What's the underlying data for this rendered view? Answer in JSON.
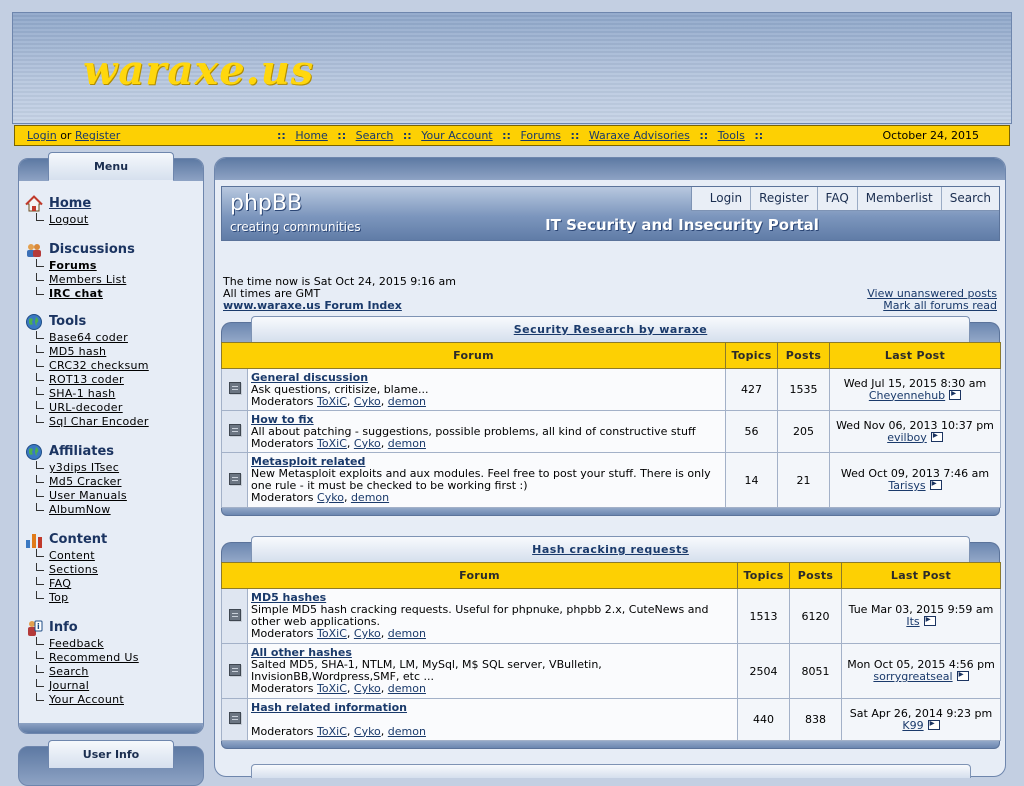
{
  "site": {
    "logo": "waraxe.us"
  },
  "navbar": {
    "login": "Login",
    "or": "or",
    "register": "Register",
    "links": [
      "Home",
      "Search",
      "Your Account",
      "Forums",
      "Waraxe Advisories",
      "Tools"
    ],
    "sep": "::",
    "date": "October 24, 2015"
  },
  "sidebar": {
    "menu_title": "Menu",
    "sections": [
      {
        "title": "Home",
        "icon": "home-icon",
        "items": [
          "Logout"
        ]
      },
      {
        "title": "Discussions",
        "icon": "users-icon",
        "items": [
          "Forums",
          "Members List",
          "IRC chat"
        ]
      },
      {
        "title": "Tools",
        "icon": "globe-icon",
        "items": [
          "Base64 coder",
          "MD5 hash",
          "CRC32 checksum",
          "ROT13 coder",
          "SHA-1 hash",
          "URL-decoder",
          "Sql Char Encoder"
        ]
      },
      {
        "title": "Affiliates",
        "icon": "globe-icon",
        "items": [
          "y3dips ITsec",
          "Md5 Cracker",
          "User Manuals",
          "AlbumNow"
        ]
      },
      {
        "title": "Content",
        "icon": "chart-icon",
        "items": [
          "Content",
          "Sections",
          "FAQ",
          "Top"
        ]
      },
      {
        "title": "Info",
        "icon": "info-icon",
        "items": [
          "Feedback",
          "Recommend Us",
          "Search",
          "Journal",
          "Your Account"
        ]
      }
    ],
    "userinfo_title": "User Info"
  },
  "banner": {
    "logo": "phpBB",
    "tagline": "creating communities",
    "title": "IT Security and Insecurity Portal",
    "buttons": [
      "Login",
      "Register",
      "FAQ",
      "Memberlist",
      "Search"
    ]
  },
  "info": {
    "time_now": "The time now is Sat Oct 24, 2015 9:16 am",
    "timezone": "All times are GMT",
    "index_link": "www.waraxe.us Forum Index",
    "unanswered": "View unanswered posts",
    "mark_read": "Mark all forums read"
  },
  "table_headers": {
    "forum": "Forum",
    "topics": "Topics",
    "posts": "Posts",
    "last_post": "Last Post",
    "moderators": "Moderators"
  },
  "categories": [
    {
      "title": "Security Research by waraxe",
      "forums": [
        {
          "name": "General discussion",
          "desc": "Ask questions, critisize, blame...",
          "mods": [
            "ToXiC",
            "Cyko",
            "demon"
          ],
          "topics": "427",
          "posts": "1535",
          "last_date": "Wed Jul 15, 2015 8:30 am",
          "last_user": "Cheyennehub"
        },
        {
          "name": "How to fix",
          "desc": "All about patching - suggestions, possible problems, all kind of constructive stuff",
          "mods": [
            "ToXiC",
            "Cyko",
            "demon"
          ],
          "topics": "56",
          "posts": "205",
          "last_date": "Wed Nov 06, 2013 10:37 pm",
          "last_user": "evilboy"
        },
        {
          "name": "Metasploit related",
          "desc": "New Metasploit exploits and aux modules. Feel free to post your stuff. There is only one rule - it must be checked to be working first :)",
          "mods": [
            "Cyko",
            "demon"
          ],
          "topics": "14",
          "posts": "21",
          "last_date": "Wed Oct 09, 2013 7:46 am",
          "last_user": "Tarisys"
        }
      ]
    },
    {
      "title": "Hash cracking requests",
      "forums": [
        {
          "name": "MD5 hashes",
          "desc": "Simple MD5 hash cracking requests. Useful for phpnuke, phpbb 2.x, CuteNews and other web applications.",
          "mods": [
            "ToXiC",
            "Cyko",
            "demon"
          ],
          "topics": "1513",
          "posts": "6120",
          "last_date": "Tue Mar 03, 2015 9:59 am",
          "last_user": "Its"
        },
        {
          "name": "All other hashes",
          "desc": "Salted MD5, SHA-1, NTLM, LM, MySql, M$ SQL server, VBulletin, InvisionBB,Wordpress,SMF, etc ...",
          "mods": [
            "ToXiC",
            "Cyko",
            "demon"
          ],
          "topics": "2504",
          "posts": "8051",
          "last_date": "Mon Oct 05, 2015 4:56 pm",
          "last_user": "sorrygreatseal"
        },
        {
          "name": "Hash related information",
          "desc": "",
          "mods": [
            "ToXiC",
            "Cyko",
            "demon"
          ],
          "topics": "440",
          "posts": "838",
          "last_date": "Sat Apr 26, 2014 9:23 pm",
          "last_user": "K99"
        }
      ]
    }
  ]
}
